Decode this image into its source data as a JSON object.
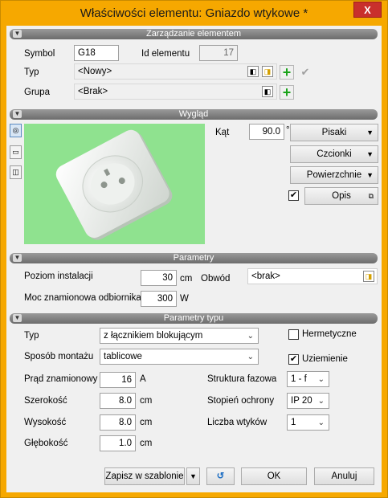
{
  "window": {
    "title": "Właściwości elementu: Gniazdo wtykowe *",
    "close_glyph": "X"
  },
  "sections": {
    "management": "Zarządzanie elementem",
    "appearance": "Wygląd",
    "parameters": "Parametry",
    "type_parameters": "Parametry typu"
  },
  "management": {
    "symbol_label": "Symbol",
    "symbol_value": "G18",
    "id_label": "Id elementu",
    "id_value": "17",
    "type_label": "Typ",
    "type_value": "<Nowy>",
    "group_label": "Grupa",
    "group_value": "<Brak>"
  },
  "appearance": {
    "angle_label": "Kąt",
    "angle_value": "90.0",
    "angle_unit": "°",
    "buttons": {
      "pens": "Pisaki",
      "fonts": "Czcionki",
      "surfaces": "Powierzchnie",
      "description": "Opis"
    },
    "description_checked": true
  },
  "parameters": {
    "install_level_label": "Poziom instalacji",
    "install_level_value": "30",
    "install_level_unit": "cm",
    "circuit_label": "Obwód",
    "circuit_value": "<brak>",
    "power_label": "Moc znamionowa odbiornika",
    "power_value": "300",
    "power_unit": "W"
  },
  "type_parameters": {
    "type_label": "Typ",
    "type_value": "z łącznikiem blokującym",
    "mount_label": "Sposób montażu",
    "mount_value": "tablicowe",
    "hermetic_label": "Hermetyczne",
    "hermetic_checked": false,
    "ground_label": "Uziemienie",
    "ground_checked": true,
    "current_label": "Prąd znamionowy",
    "current_value": "16",
    "current_unit": "A",
    "width_label": "Szerokość",
    "width_value": "8.0",
    "width_unit": "cm",
    "height_label": "Wysokość",
    "height_value": "8.0",
    "height_unit": "cm",
    "depth_label": "Głębokość",
    "depth_value": "1.0",
    "depth_unit": "cm",
    "phase_label": "Struktura fazowa",
    "phase_value": "1 - f",
    "protection_label": "Stopień ochrony",
    "protection_value": "IP 20",
    "plugs_label": "Liczba wtyków",
    "plugs_value": "1"
  },
  "footer": {
    "save_template": "Zapisz w szablonie",
    "ok": "OK",
    "cancel": "Anuluj"
  },
  "colors": {
    "frame": "#f6a800",
    "preview_bg": "#8fe28f",
    "plus_green": "#1aa31a"
  }
}
